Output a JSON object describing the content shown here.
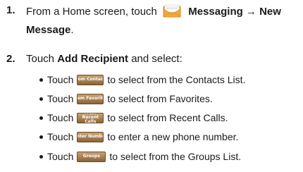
{
  "step1": {
    "number": "1.",
    "prefix": "From a Home screen, touch",
    "path": "Messaging → New",
    "path_line2": "Message",
    "suffix": ".",
    "icon": "messaging-envelope-icon"
  },
  "step2": {
    "number": "2.",
    "prefix": "Touch",
    "bold": "Add Recipient",
    "suffix": "and select:"
  },
  "bullets": [
    {
      "touch": "Touch",
      "button_label": "From Contacts",
      "text": "to select from the Contacts List."
    },
    {
      "touch": "Touch",
      "button_label": "From Favorites",
      "text": "to select from Favorites."
    },
    {
      "touch": "Touch",
      "button_label": "From Recent Calls",
      "text": "to select from Recent Calls."
    },
    {
      "touch": "Touch",
      "button_label": "Enter Number",
      "text": "to enter a new phone number."
    },
    {
      "touch": "Touch",
      "button_label": "Groups",
      "text": "to select from the Groups List."
    }
  ],
  "colors": {
    "button_gradient_top": "#c7a373",
    "button_gradient_bottom": "#8b6339",
    "envelope": "#f2a93b"
  }
}
